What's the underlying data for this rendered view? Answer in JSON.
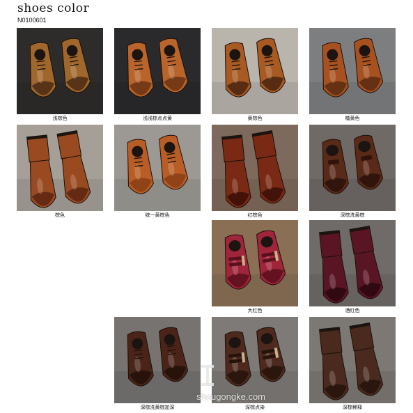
{
  "header": {
    "title": "shoes color",
    "code": "N0100601"
  },
  "watermark": "shougongke.com",
  "tiles": [
    {
      "caption": "浅棕色",
      "bg": "#2e2c2a",
      "shoe": "#a0672c",
      "tip": "#4a2b14",
      "style": "oxford"
    },
    {
      "caption": "浅浅棕点点黄",
      "bg": "#2a2a2c",
      "shoe": "#b8642a",
      "tip": "#6b3314",
      "style": "oxford"
    },
    {
      "caption": "黄棕色",
      "bg": "#b9b4ac",
      "shoe": "#a85a22",
      "tip": "#4a2510",
      "style": "oxford"
    },
    {
      "caption": "橘黄色",
      "bg": "#7d7e7f",
      "shoe": "#a85120",
      "tip": "#5a2a10",
      "style": "oxford"
    },
    {
      "caption": "棕色",
      "bg": "#a59f98",
      "shoe": "#9a4a20",
      "tip": "#5a2512",
      "style": "boot"
    },
    {
      "caption": "统一黄棕色",
      "bg": "#9c9994",
      "shoe": "#b85d25",
      "tip": "#8a3e16",
      "style": "oxford"
    },
    {
      "caption": "红棕色",
      "bg": "#7e6a5c",
      "shoe": "#7a2a14",
      "tip": "#3a0f08",
      "style": "boot"
    },
    {
      "caption": "深棕洗黄棕",
      "bg": "#6f6a66",
      "shoe": "#5a2a18",
      "tip": "#2a120a",
      "style": "loafer"
    },
    {
      "caption": "大红色",
      "bg": "#8a6f55",
      "shoe": "#a0243a",
      "tip": "#5a0f1c",
      "style": "monk"
    },
    {
      "caption": "酒红色",
      "bg": "#6e6b68",
      "shoe": "#5a1524",
      "tip": "#2a070f",
      "style": "boot"
    },
    {
      "caption": "深棕洗黄棕加深",
      "bg": "#767371",
      "shoe": "#4a2418",
      "tip": "#22100a",
      "style": "oxford"
    },
    {
      "caption": "深棕点染",
      "bg": "#7d7a77",
      "shoe": "#4e2a1e",
      "tip": "#26130c",
      "style": "monk"
    },
    {
      "caption": "深棕稀释",
      "bg": "#7c7975",
      "shoe": "#4a2a1e",
      "tip": "#24130c",
      "style": "boot"
    }
  ]
}
